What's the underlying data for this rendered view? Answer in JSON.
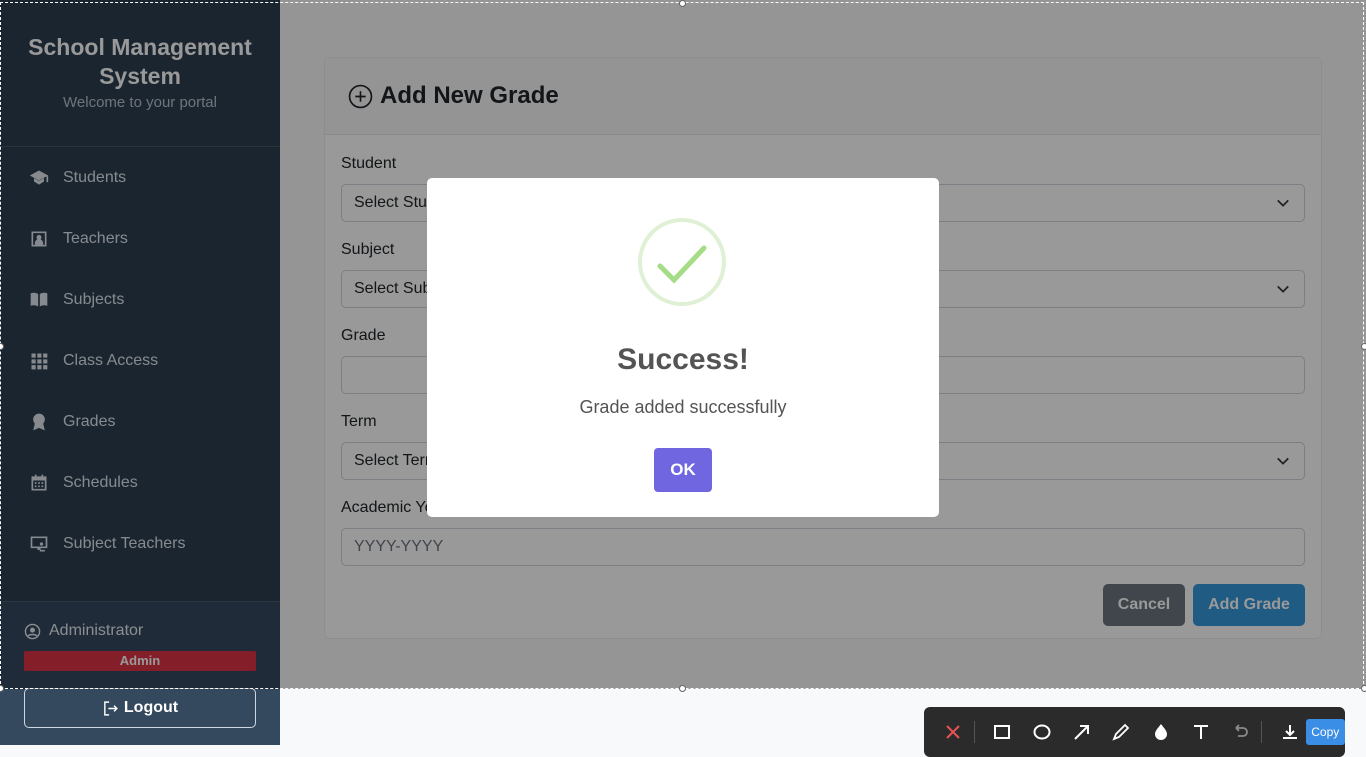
{
  "sidebar": {
    "title": "School Management System",
    "subtitle": "Welcome to your portal",
    "items": [
      {
        "label": "Students",
        "icon": "graduation-cap-icon"
      },
      {
        "label": "Teachers",
        "icon": "teacher-board-icon"
      },
      {
        "label": "Subjects",
        "icon": "book-icon"
      },
      {
        "label": "Class Access",
        "icon": "grid-icon"
      },
      {
        "label": "Grades",
        "icon": "award-icon"
      },
      {
        "label": "Schedules",
        "icon": "calendar-icon"
      },
      {
        "label": "Subject Teachers",
        "icon": "presentation-icon"
      }
    ],
    "user_name": "Administrator",
    "role": "Admin",
    "logout_label": "Logout"
  },
  "form": {
    "title": "Add New Grade",
    "student_label": "Student",
    "student_value": "Select Student",
    "subject_label": "Subject",
    "subject_value": "Select Subject",
    "grade_label": "Grade",
    "grade_value": "",
    "term_label": "Term",
    "term_value": "Select Term",
    "year_label": "Academic Year",
    "year_placeholder": "YYYY-YYYY",
    "cancel_label": "Cancel",
    "submit_label": "Add Grade"
  },
  "modal": {
    "title": "Success!",
    "message": "Grade added successfully",
    "ok_label": "OK"
  },
  "toolbar": {
    "copy_label": "Copy",
    "tools": [
      "close-icon",
      "rectangle-icon",
      "ellipse-icon",
      "arrow-icon",
      "pen-icon",
      "blur-icon",
      "text-icon",
      "undo-icon",
      "download-icon"
    ]
  },
  "colors": {
    "sidebar": "#2c3e50",
    "primary": "#3498db",
    "danger": "#dc3545",
    "confirm": "#7066e0",
    "success": "#a5dc86"
  }
}
